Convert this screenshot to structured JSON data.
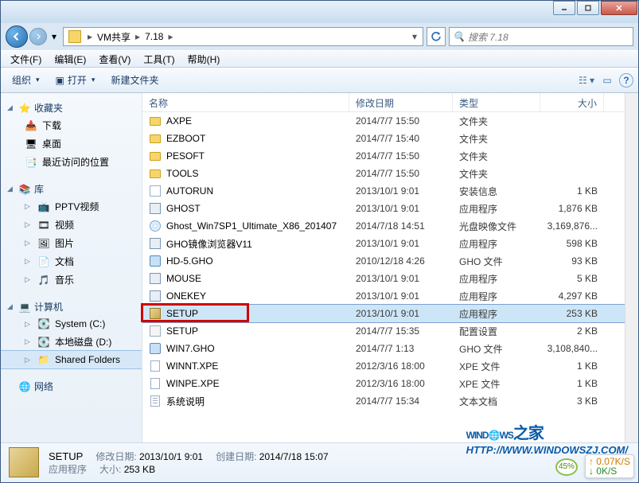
{
  "titlebar": {},
  "nav": {},
  "address": {
    "seg1": "VM共享",
    "seg2": "7.18"
  },
  "search": {
    "placeholder": "搜索 7.18"
  },
  "menu": {
    "file": "文件(F)",
    "edit": "编辑(E)",
    "view": "查看(V)",
    "tools": "工具(T)",
    "help": "帮助(H)"
  },
  "toolbar": {
    "organize": "组织",
    "open": "打开",
    "newfolder": "新建文件夹"
  },
  "headers": {
    "name": "名称",
    "date": "修改日期",
    "type": "类型",
    "size": "大小"
  },
  "navpane": {
    "favorites": "收藏夹",
    "downloads": "下载",
    "desktop": "桌面",
    "recent": "最近访问的位置",
    "libraries": "库",
    "pptv": "PPTV视频",
    "videos": "视频",
    "pictures": "图片",
    "documents": "文档",
    "music": "音乐",
    "computer": "计算机",
    "systemc": "System (C:)",
    "locald": "本地磁盘 (D:)",
    "shared": "Shared Folders",
    "network": "网络"
  },
  "files": [
    {
      "icon": "folder",
      "name": "AXPE",
      "date": "2014/7/7 15:50",
      "type": "文件夹",
      "size": ""
    },
    {
      "icon": "folder",
      "name": "EZBOOT",
      "date": "2014/7/7 15:40",
      "type": "文件夹",
      "size": ""
    },
    {
      "icon": "folder",
      "name": "PESOFT",
      "date": "2014/7/7 15:50",
      "type": "文件夹",
      "size": ""
    },
    {
      "icon": "folder",
      "name": "TOOLS",
      "date": "2014/7/7 15:50",
      "type": "文件夹",
      "size": ""
    },
    {
      "icon": "inf",
      "name": "AUTORUN",
      "date": "2013/10/1 9:01",
      "type": "安装信息",
      "size": "1 KB"
    },
    {
      "icon": "exe",
      "name": "GHOST",
      "date": "2013/10/1 9:01",
      "type": "应用程序",
      "size": "1,876 KB"
    },
    {
      "icon": "iso",
      "name": "Ghost_Win7SP1_Ultimate_X86_201407",
      "date": "2014/7/18 14:51",
      "type": "光盘映像文件",
      "size": "3,169,876..."
    },
    {
      "icon": "exe",
      "name": "GHO镜像浏览器V11",
      "date": "2013/10/1 9:01",
      "type": "应用程序",
      "size": "598 KB"
    },
    {
      "icon": "gho",
      "name": "HD-5.GHO",
      "date": "2010/12/18 4:26",
      "type": "GHO 文件",
      "size": "93 KB"
    },
    {
      "icon": "exe",
      "name": "MOUSE",
      "date": "2013/10/1 9:01",
      "type": "应用程序",
      "size": "5 KB"
    },
    {
      "icon": "exe",
      "name": "ONEKEY",
      "date": "2013/10/1 9:01",
      "type": "应用程序",
      "size": "4,297 KB"
    },
    {
      "icon": "setup",
      "name": "SETUP",
      "date": "2013/10/1 9:01",
      "type": "应用程序",
      "size": "253 KB",
      "selected": true,
      "highlighted": true
    },
    {
      "icon": "ini",
      "name": "SETUP",
      "date": "2014/7/7 15:35",
      "type": "配置设置",
      "size": "2 KB"
    },
    {
      "icon": "gho",
      "name": "WIN7.GHO",
      "date": "2014/7/7 1:13",
      "type": "GHO 文件",
      "size": "3,108,840..."
    },
    {
      "icon": "file",
      "name": "WINNT.XPE",
      "date": "2012/3/16 18:00",
      "type": "XPE 文件",
      "size": "1 KB"
    },
    {
      "icon": "file",
      "name": "WINPE.XPE",
      "date": "2012/3/16 18:00",
      "type": "XPE 文件",
      "size": "1 KB"
    },
    {
      "icon": "txt",
      "name": "系统说明",
      "date": "2014/7/7 15:34",
      "type": "文本文档",
      "size": "3 KB"
    }
  ],
  "details": {
    "name": "SETUP",
    "mod_label": "修改日期:",
    "mod": "2013/10/1 9:01",
    "create_label": "创建日期:",
    "create": "2014/7/18 15:07",
    "type": "应用程序",
    "size_label": "大小:",
    "size": "253 KB"
  },
  "watermark": {
    "text1": "WIND",
    "text2": "WS",
    "suffix": "之家",
    "url": "HTTP://WWW.WINDOWSZJ.COM/"
  },
  "netspeed": {
    "up": "0.07K/S",
    "dn": "0K/S",
    "pct": "45%"
  }
}
